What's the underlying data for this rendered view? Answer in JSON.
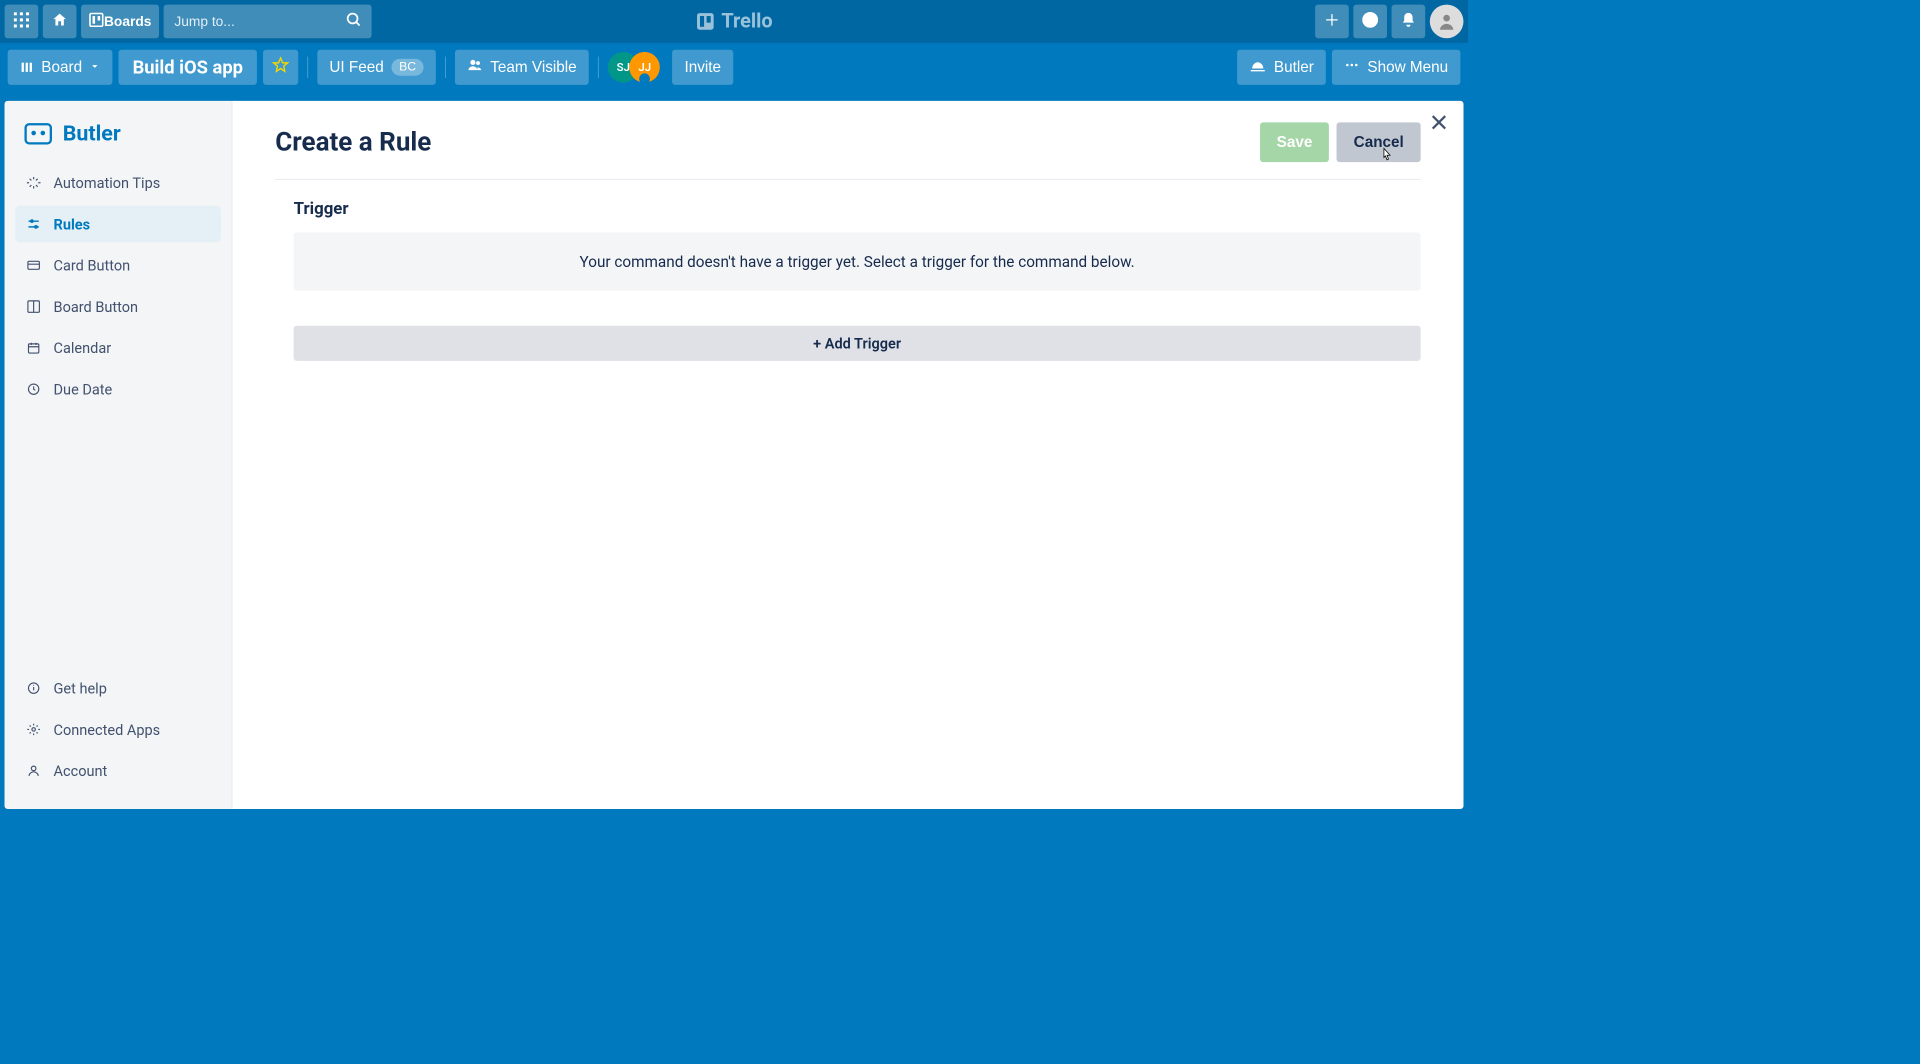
{
  "brand": "Trello",
  "header": {
    "boards_label": "Boards",
    "search_placeholder": "Jump to..."
  },
  "board_bar": {
    "board_menu_label": "Board",
    "board_title": "Build iOS app",
    "ui_feed_label": "UI Feed",
    "ui_feed_badge": "BC",
    "team_visible_label": "Team Visible",
    "invite_label": "Invite",
    "members": [
      {
        "initials": "SJ"
      },
      {
        "initials": "JJ"
      }
    ],
    "butler_label": "Butler",
    "show_menu_label": "Show Menu"
  },
  "sidebar": {
    "title": "Butler",
    "items": [
      {
        "icon": "sparkle",
        "label": "Automation Tips"
      },
      {
        "icon": "sliders",
        "label": "Rules",
        "active": true
      },
      {
        "icon": "card",
        "label": "Card Button"
      },
      {
        "icon": "board",
        "label": "Board Button"
      },
      {
        "icon": "calendar",
        "label": "Calendar"
      },
      {
        "icon": "clock",
        "label": "Due Date"
      }
    ],
    "footer": [
      {
        "icon": "info",
        "label": "Get help"
      },
      {
        "icon": "gear",
        "label": "Connected Apps"
      },
      {
        "icon": "user",
        "label": "Account"
      }
    ]
  },
  "content": {
    "page_title": "Create a Rule",
    "save_label": "Save",
    "cancel_label": "Cancel",
    "trigger_heading": "Trigger",
    "trigger_empty_msg": "Your command doesn't have a trigger yet. Select a trigger for the command below.",
    "add_trigger_label": "+ Add Trigger"
  }
}
